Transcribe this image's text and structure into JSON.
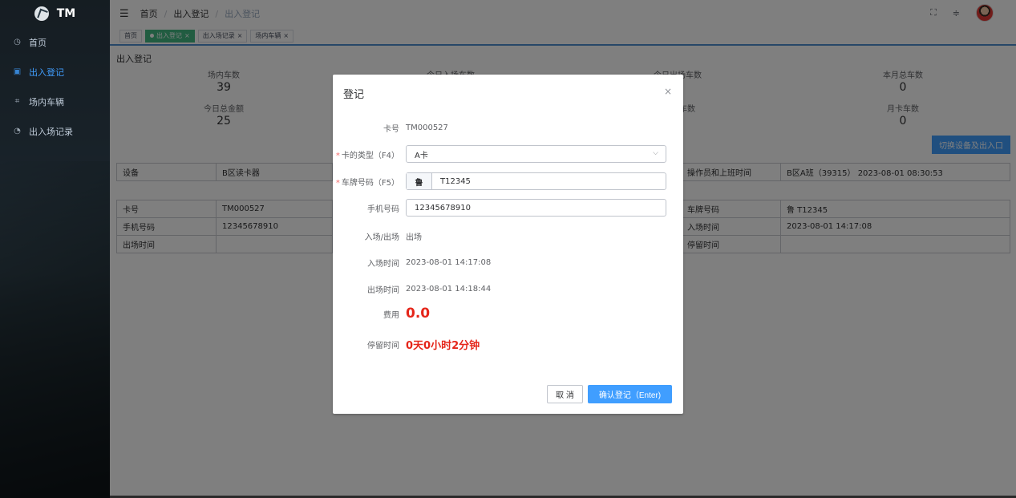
{
  "app": {
    "logo_text": "TM"
  },
  "sidebar": {
    "items": [
      {
        "label": "首页",
        "icon": "dashboard-icon"
      },
      {
        "label": "出入登记",
        "icon": "register-icon"
      },
      {
        "label": "场内车辆",
        "icon": "vehicles-icon"
      },
      {
        "label": "出入场记录",
        "icon": "clock-icon"
      }
    ]
  },
  "breadcrumb": {
    "home": "首页",
    "level1": "出入登记",
    "level2": "出入登记"
  },
  "tags": [
    {
      "label": "首页"
    },
    {
      "label": "出入登记"
    },
    {
      "label": "出入场记录"
    },
    {
      "label": "场内车辆"
    }
  ],
  "main": {
    "title": "出入登记",
    "stats": {
      "in_lot": {
        "label": "场内车数",
        "value": "39"
      },
      "today_in": {
        "label": "今日入场车数"
      },
      "today_out": {
        "label": "今日出场车数"
      },
      "month_total": {
        "label": "本月总车数",
        "value": "0"
      },
      "today_amount": {
        "label": "今日总金额",
        "value": "25"
      },
      "hidden_mid": {
        "label": "车数"
      },
      "monthly_cards": {
        "label": "月卡车数",
        "value": "0"
      }
    },
    "switch_button": "切换设备及出入口",
    "device_table": {
      "device_label": "设备",
      "device_value": "B区读卡器",
      "operator_label": "操作员和上班时间",
      "operator_value": "B区A班（39315） 2023-08-01 08:30:53"
    },
    "record_table": {
      "card_label": "卡号",
      "card_value": "TM000527",
      "plate_label": "车牌号码",
      "plate_value": "鲁 T12345",
      "phone_label": "手机号码",
      "phone_value": "12345678910",
      "in_time_label": "入场时间",
      "in_time_value": "2023-08-01 14:17:08",
      "out_time_label": "出场时间",
      "stay_label": "停留时间"
    }
  },
  "dialog": {
    "title": "登记",
    "close": "×",
    "card_no_label": "卡号",
    "card_no_value": "TM000527",
    "card_type_label": "卡的类型（F4）",
    "card_type_value": "A卡",
    "plate_label": "车牌号码（F5）",
    "plate_prefix": "鲁",
    "plate_number": "T12345",
    "phone_label": "手机号码",
    "phone_value": "12345678910",
    "direction_label": "入场/出场",
    "direction_value": "出场",
    "in_time_label": "入场时间",
    "in_time_value": "2023-08-01 14:17:08",
    "out_time_label": "出场时间",
    "out_time_value": "2023-08-01 14:18:44",
    "fee_label": "费用",
    "fee_value": "0.0",
    "stay_label": "停留时间",
    "stay_value": "0天0小时2分钟",
    "cancel_button": "取 消",
    "confirm_button": "确认登记（Enter)"
  },
  "colors": {
    "primary": "#409eff",
    "active_tag": "#42b983",
    "fee_red": "#e5261a"
  }
}
